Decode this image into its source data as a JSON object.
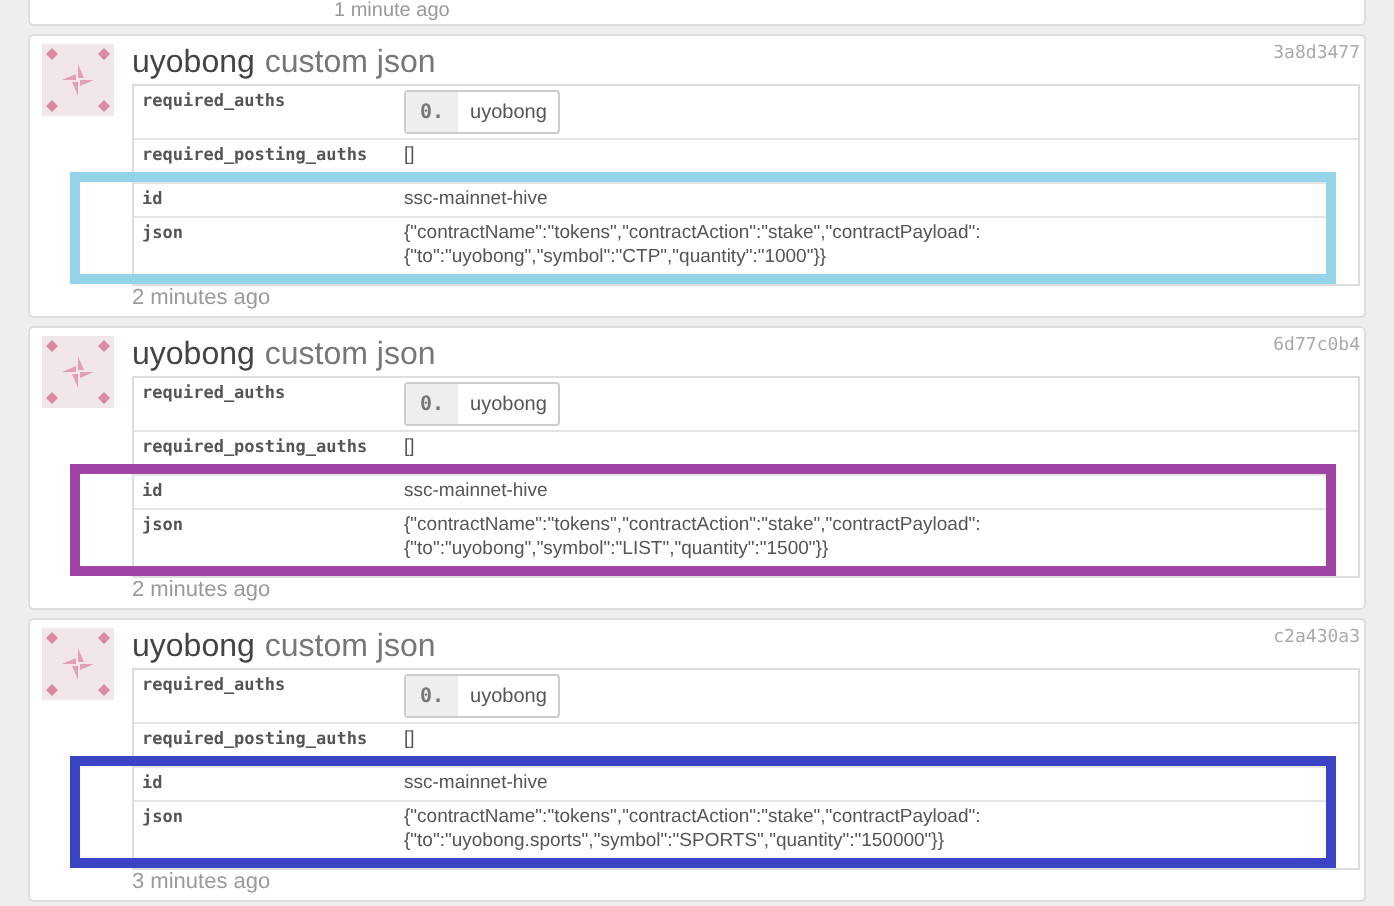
{
  "previous_card": {
    "time": "1 minute ago"
  },
  "operations": [
    {
      "author": "uyobong",
      "type": "custom json",
      "hash": "3a8d3477",
      "time": "2 minutes ago",
      "params": [
        {
          "key": "required_auths",
          "kind": "list",
          "items": [
            {
              "index": "0.",
              "value": "uyobong"
            }
          ]
        },
        {
          "key": "required_posting_auths",
          "kind": "text",
          "value": "[]"
        }
      ],
      "highlight": {
        "color": "#93d4e8",
        "params": [
          {
            "key": "id",
            "kind": "text",
            "value": "ssc-mainnet-hive"
          },
          {
            "key": "json",
            "kind": "text",
            "value": "{\"contractName\":\"tokens\",\"contractAction\":\"stake\",\"contractPayload\":{\"to\":\"uyobong\",\"symbol\":\"CTP\",\"quantity\":\"1000\"}}"
          }
        ]
      }
    },
    {
      "author": "uyobong",
      "type": "custom json",
      "hash": "6d77c0b4",
      "time": "2 minutes ago",
      "params": [
        {
          "key": "required_auths",
          "kind": "list",
          "items": [
            {
              "index": "0.",
              "value": "uyobong"
            }
          ]
        },
        {
          "key": "required_posting_auths",
          "kind": "text",
          "value": "[]"
        }
      ],
      "highlight": {
        "color": "#a045a6",
        "params": [
          {
            "key": "id",
            "kind": "text",
            "value": "ssc-mainnet-hive"
          },
          {
            "key": "json",
            "kind": "text",
            "value": "{\"contractName\":\"tokens\",\"contractAction\":\"stake\",\"contractPayload\":{\"to\":\"uyobong\",\"symbol\":\"LIST\",\"quantity\":\"1500\"}}"
          }
        ]
      }
    },
    {
      "author": "uyobong",
      "type": "custom json",
      "hash": "c2a430a3",
      "time": "3 minutes ago",
      "params": [
        {
          "key": "required_auths",
          "kind": "list",
          "items": [
            {
              "index": "0.",
              "value": "uyobong"
            }
          ]
        },
        {
          "key": "required_posting_auths",
          "kind": "text",
          "value": "[]"
        }
      ],
      "highlight": {
        "color": "#3a44c4",
        "params": [
          {
            "key": "id",
            "kind": "text",
            "value": "ssc-mainnet-hive"
          },
          {
            "key": "json",
            "kind": "text",
            "value": "{\"contractName\":\"tokens\",\"contractAction\":\"stake\",\"contractPayload\":{\"to\":\"uyobong.sports\",\"symbol\":\"SPORTS\",\"quantity\":\"150000\"}}"
          }
        ]
      }
    }
  ]
}
